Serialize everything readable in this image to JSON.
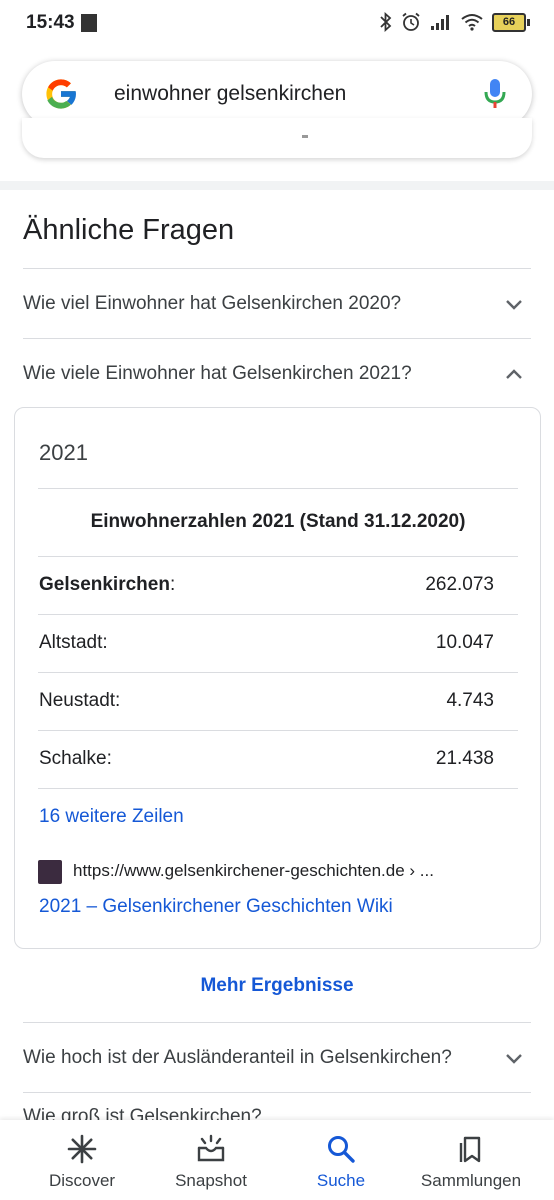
{
  "status_bar": {
    "time": "15:43",
    "battery": "66",
    "icons": [
      "bluetooth-icon",
      "alarm-icon",
      "signal-icon",
      "wifi-icon",
      "battery-icon"
    ]
  },
  "search": {
    "query": "einwohner gelsenkirchen"
  },
  "related": {
    "title": "Ähnliche Fragen",
    "questions": [
      {
        "text": "Wie viel Einwohner hat Gelsenkirchen 2020?",
        "expanded": false
      },
      {
        "text": "Wie viele Einwohner hat Gelsenkirchen 2021?",
        "expanded": true
      },
      {
        "text": "Wie hoch ist der Ausländeranteil in Gelsenkirchen?",
        "expanded": false
      }
    ],
    "cutoff_question": "Wie groß ist Gelsenkirchen?"
  },
  "answer": {
    "year": "2021",
    "table_caption": "Einwohnerzahlen 2021 (Stand 31.12.2020)",
    "rows": [
      {
        "label": "Gelsenkirchen",
        "suffix": ":",
        "value": "262.073",
        "bold": true
      },
      {
        "label": "Altstadt:",
        "value": "10.047"
      },
      {
        "label": "Neustadt:",
        "value": "4.743"
      },
      {
        "label": "Schalke:",
        "value": "21.438"
      }
    ],
    "more_rows": "16 weitere Zeilen",
    "source_url": "https://www.gelsenkirchener-geschichten.de › ...",
    "source_title": "2021 – Gelsenkirchener Geschichten Wiki"
  },
  "more_results": "Mehr Ergebnisse",
  "bottom_nav": [
    {
      "label": "Discover",
      "icon": "discover-asterisk-icon",
      "active": false
    },
    {
      "label": "Snapshot",
      "icon": "snapshot-tray-icon",
      "active": false
    },
    {
      "label": "Suche",
      "icon": "search-icon",
      "active": true
    },
    {
      "label": "Sammlungen",
      "icon": "collections-bookmark-icon",
      "active": false
    }
  ],
  "colors": {
    "link": "#1558d6",
    "divider": "#dadce0",
    "separator": "#f1f3f4",
    "battery": "#e7d15a"
  }
}
